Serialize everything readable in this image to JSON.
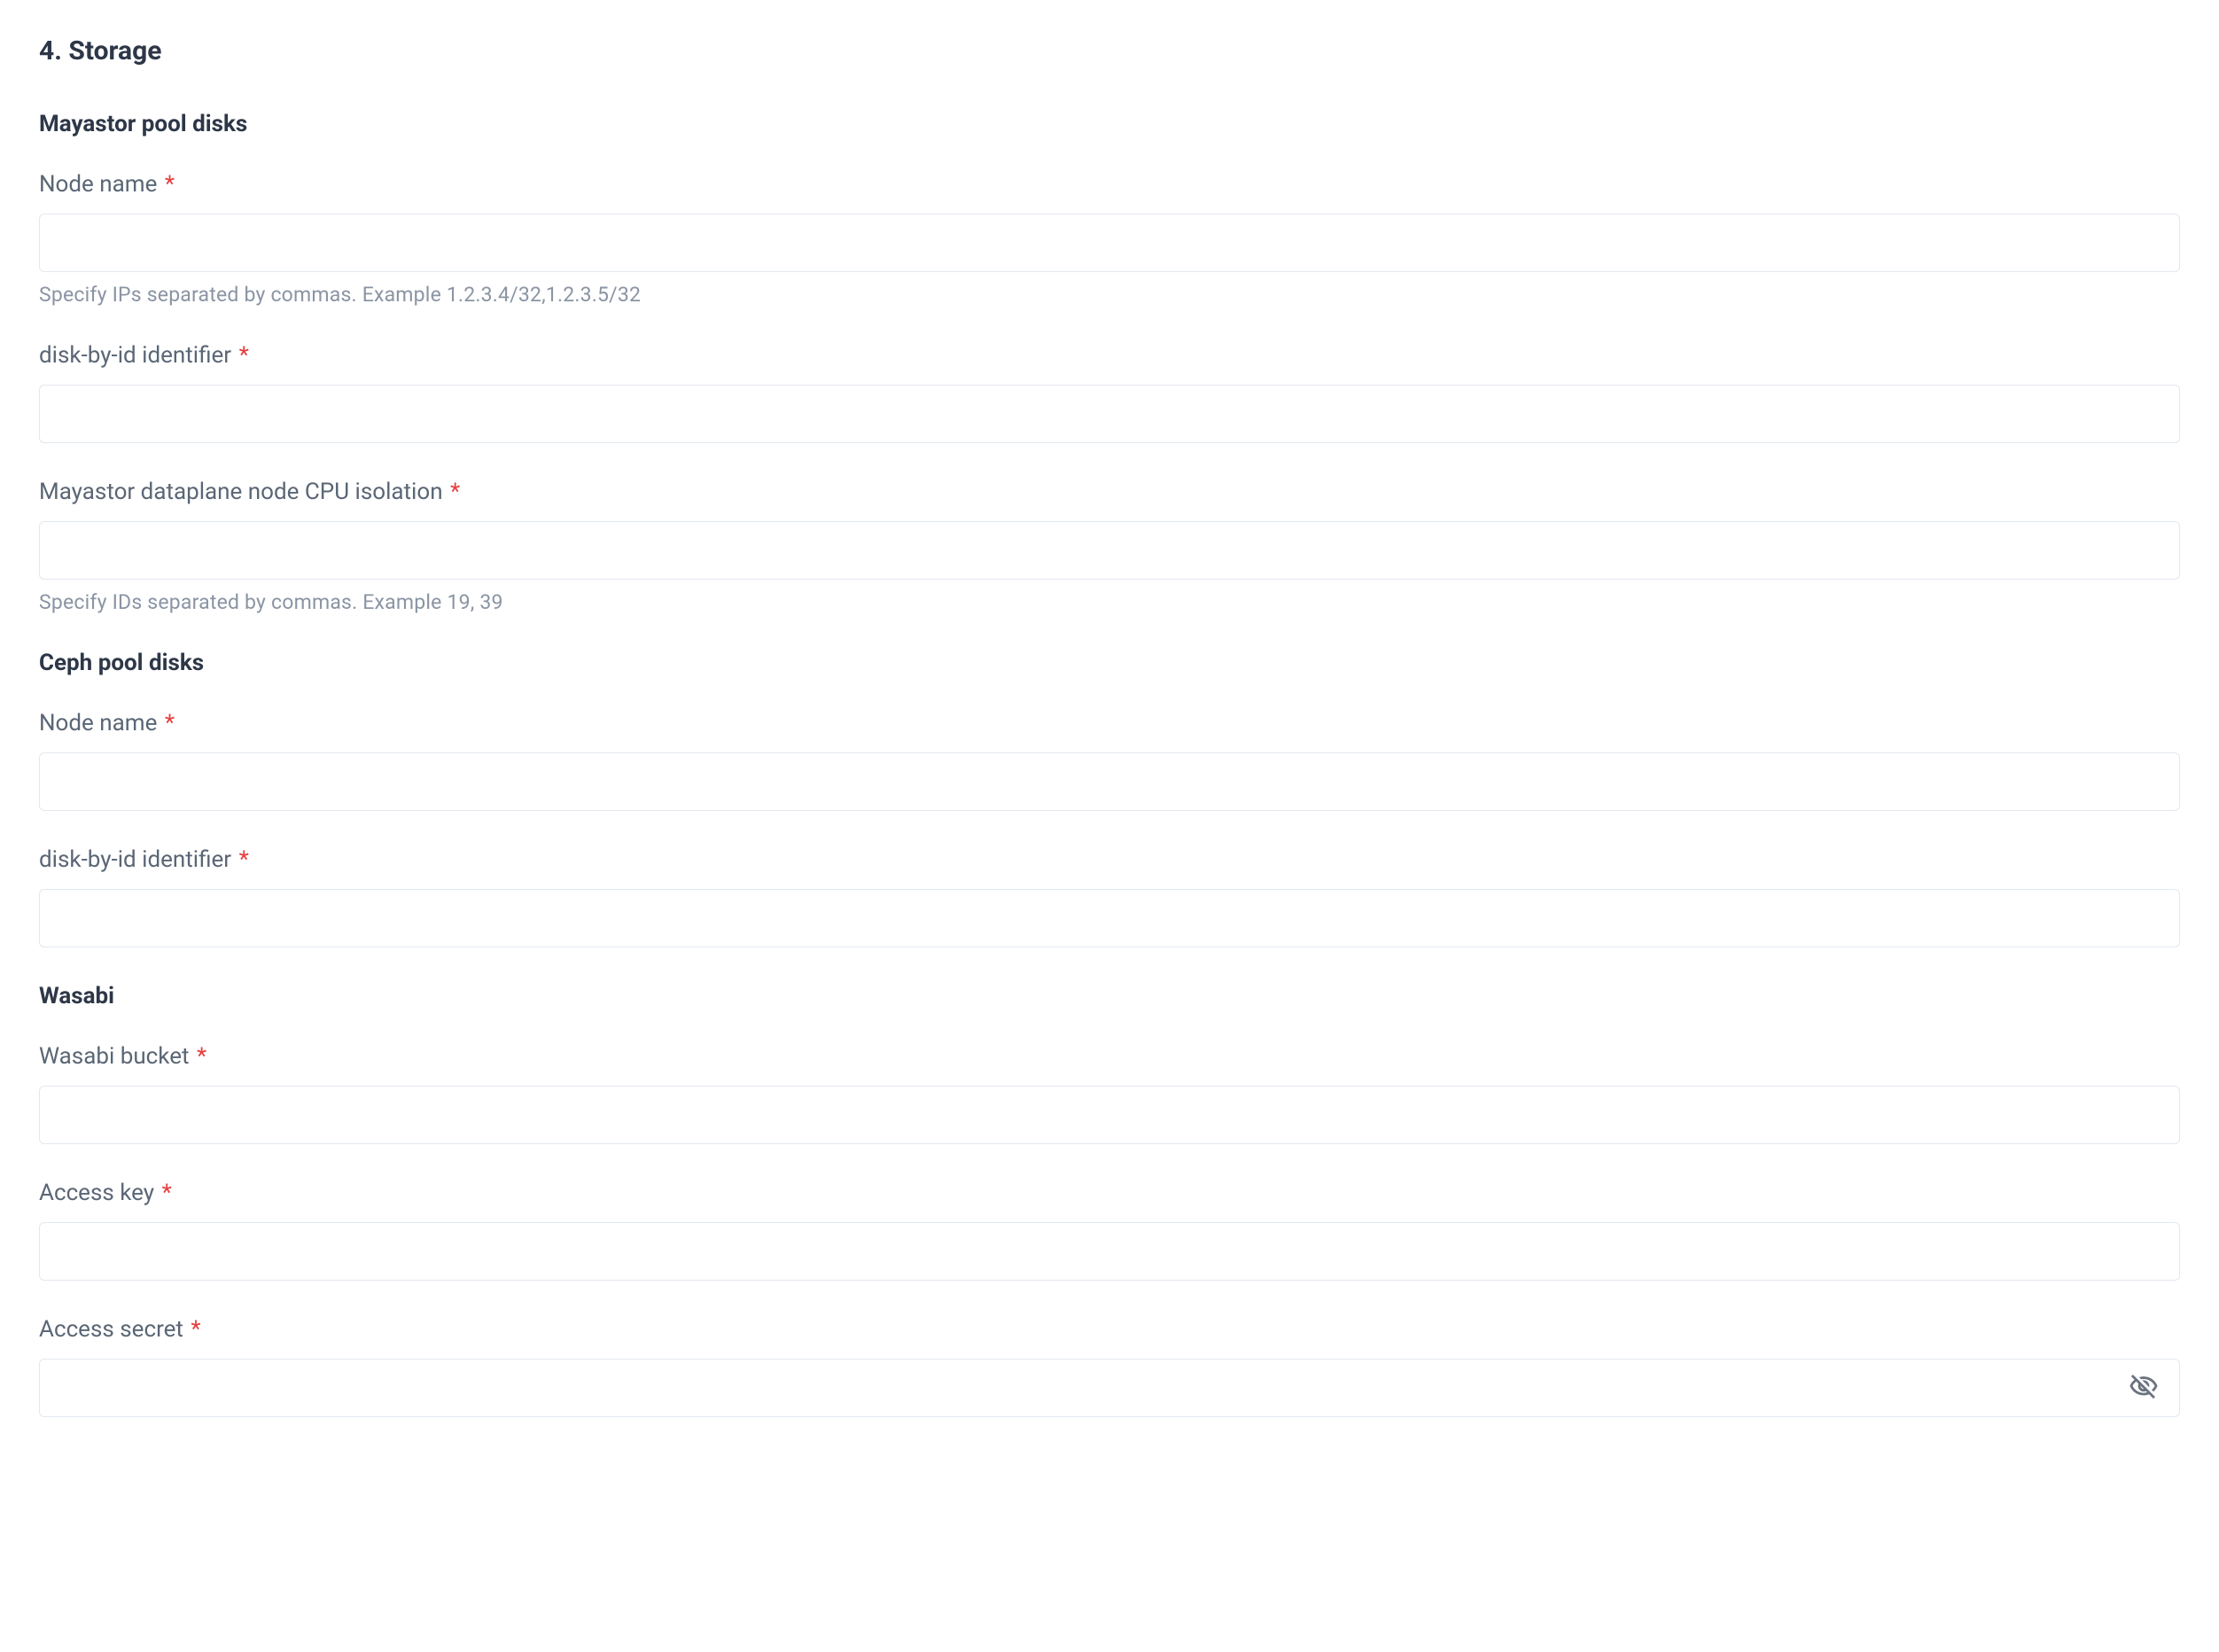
{
  "section": {
    "title": "4. Storage"
  },
  "mayastor": {
    "heading": "Mayastor pool disks",
    "nodeName": {
      "label": "Node name",
      "value": "",
      "help": "Specify IPs separated by commas. Example 1.2.3.4/32,1.2.3.5/32"
    },
    "diskById": {
      "label": "disk-by-id identifier",
      "value": ""
    },
    "cpuIsolation": {
      "label": "Mayastor dataplane node CPU isolation",
      "value": "",
      "help": "Specify IDs separated by commas. Example 19, 39"
    }
  },
  "ceph": {
    "heading": "Ceph pool disks",
    "nodeName": {
      "label": "Node name",
      "value": ""
    },
    "diskById": {
      "label": "disk-by-id identifier",
      "value": ""
    }
  },
  "wasabi": {
    "heading": "Wasabi",
    "bucket": {
      "label": "Wasabi bucket",
      "value": ""
    },
    "accessKey": {
      "label": "Access key",
      "value": ""
    },
    "accessSecret": {
      "label": "Access secret",
      "value": ""
    }
  }
}
